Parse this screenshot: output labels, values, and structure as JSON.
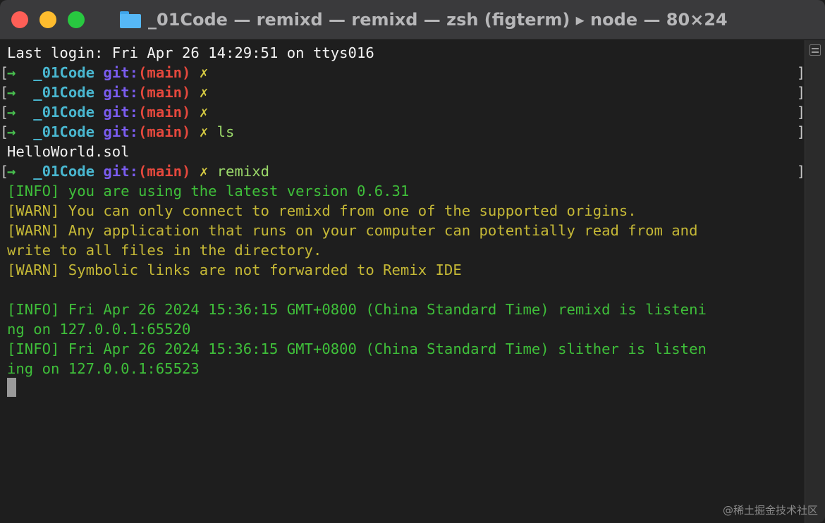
{
  "window": {
    "title": "_01Code — remixd — remixd — zsh (figterm) ▸ node — 80×24"
  },
  "prompt": {
    "arrow": "→",
    "dir": "_01Code",
    "git": "git:",
    "branch": "(main)",
    "dirty": "✗"
  },
  "terminal": {
    "last_login": "Last login: Fri Apr 26 14:29:51 on ttys016",
    "cmd_ls": "ls",
    "ls_output": "HelloWorld.sol",
    "cmd_remixd": "remixd",
    "info_version": "[INFO] you are using the latest version 0.6.31",
    "warn_origins": "[WARN] You can only connect to remixd from one of the supported origins.",
    "warn_app_1": "[WARN] Any application that runs on your computer can potentially read from and",
    "warn_app_2": "write to all files in the directory.",
    "warn_symlinks": "[WARN] Symbolic links are not forwarded to Remix IDE",
    "info_remixd_1": "[INFO] Fri Apr 26 2024 15:36:15 GMT+0800 (China Standard Time) remixd is listeni",
    "info_remixd_2": "ng on 127.0.0.1:65520",
    "info_slither_1": "[INFO] Fri Apr 26 2024 15:36:15 GMT+0800 (China Standard Time) slither is listen",
    "info_slither_2": "ing on 127.0.0.1:65523"
  },
  "watermark": "@稀土掘金技术社区",
  "colors": {
    "prompt_arrow": "#48c04f",
    "prompt_dir": "#49b7d0",
    "prompt_git": "#7a5cf0",
    "prompt_branch": "#e5483d",
    "info": "#3fbf3a",
    "warn": "#c5b836"
  },
  "icons": {
    "titlebar": "folder-icon",
    "scrollbar": "scroll-marks-icon"
  }
}
